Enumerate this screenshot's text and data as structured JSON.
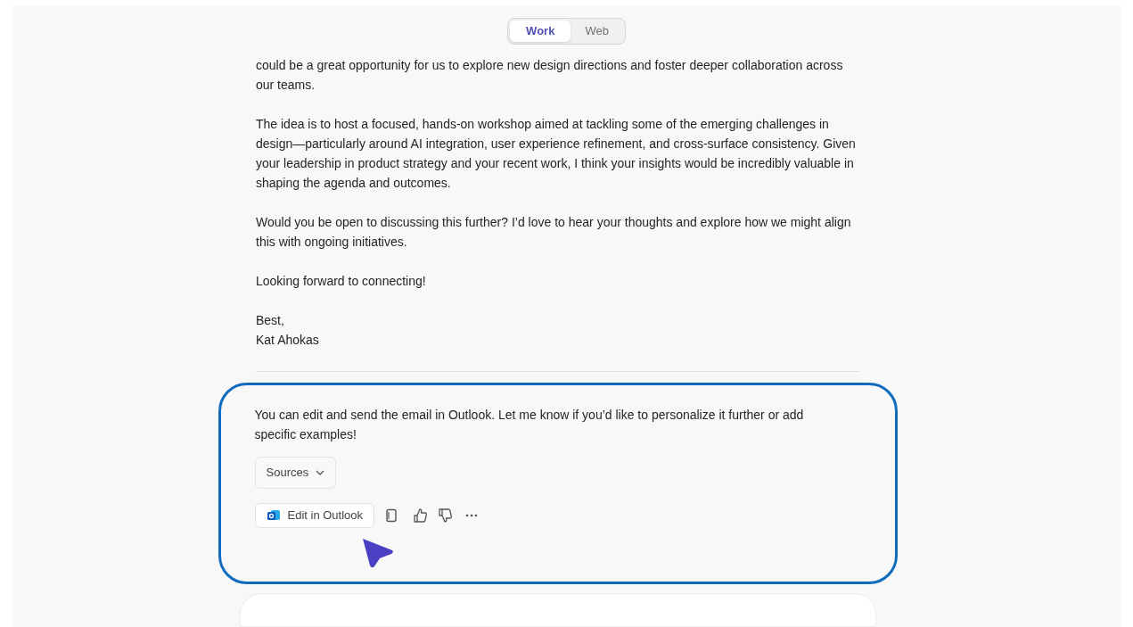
{
  "mode_tabs": [
    {
      "label": "Work",
      "selected": true
    },
    {
      "label": "Web",
      "selected": false
    }
  ],
  "email_body": [
    "could be a great opportunity for us to explore new design directions and foster deeper collaboration across our teams.",
    "The idea is to host a focused, hands-on workshop aimed at tackling some of the emerging challenges in design—particularly around AI integration, user experience refinement, and cross-surface consistency. Given your leadership in product strategy and your recent work, I think your insights would be incredibly valuable in shaping the agenda and outcomes.",
    "Would you be open to discussing this further? I’d love to hear your thoughts and explore how we might align this with ongoing initiatives.",
    "Looking forward to connecting!"
  ],
  "signoff": "Best,",
  "signature": "Kat Ahokas",
  "response": {
    "message": "You can edit and send the email in Outlook. Let me know if you’d like to personalize it further or add specific examples!",
    "sources_button": "Sources",
    "edit_button": "Edit in Outlook"
  }
}
